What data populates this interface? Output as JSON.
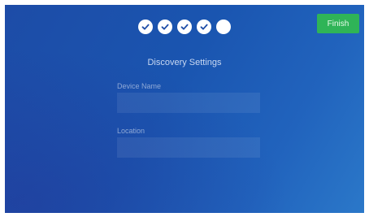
{
  "wizard": {
    "steps": [
      {
        "state": "completed",
        "icon": "checkmark-icon"
      },
      {
        "state": "completed",
        "icon": "checkmark-icon"
      },
      {
        "state": "completed",
        "icon": "checkmark-icon"
      },
      {
        "state": "completed",
        "icon": "checkmark-icon"
      },
      {
        "state": "current",
        "icon": ""
      }
    ],
    "finish_label": "Finish"
  },
  "form": {
    "title": "Discovery Settings",
    "device_name": {
      "label": "Device Name",
      "value": "",
      "placeholder": ""
    },
    "location": {
      "label": "Location",
      "value": "",
      "placeholder": ""
    }
  },
  "colors": {
    "background_start": "#1d4ca7",
    "background_end": "#2b78c9",
    "accent_green": "#2fb457",
    "step_fill": "#ffffff",
    "check_color": "#1d4ca7"
  }
}
